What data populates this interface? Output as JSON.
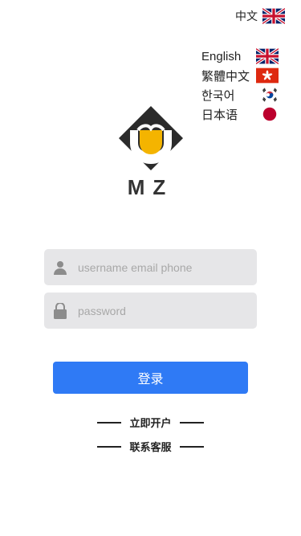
{
  "header": {
    "current_language": "中文",
    "current_flag_icon": "uk-flag-icon"
  },
  "language_menu": {
    "items": [
      {
        "label": "English",
        "flag_icon": "uk-flag-icon"
      },
      {
        "label": "繁體中文",
        "flag_icon": "hong-kong-flag-icon"
      },
      {
        "label": "한국어",
        "flag_icon": "korea-flag-icon"
      },
      {
        "label": "日本语",
        "flag_icon": "japan-flag-icon"
      }
    ]
  },
  "logo": {
    "text": "MZ",
    "colors": {
      "dark": "#2b2b2b",
      "accent": "#f4b400"
    }
  },
  "form": {
    "username_placeholder": "username email phone",
    "username_icon": "user-icon",
    "password_placeholder": "password",
    "password_icon": "lock-icon",
    "login_label": "登录"
  },
  "links": {
    "open_account": "立即开户",
    "contact_service": "联系客服"
  },
  "colors": {
    "primary": "#2f7af5",
    "field_bg": "#e6e6e8"
  }
}
